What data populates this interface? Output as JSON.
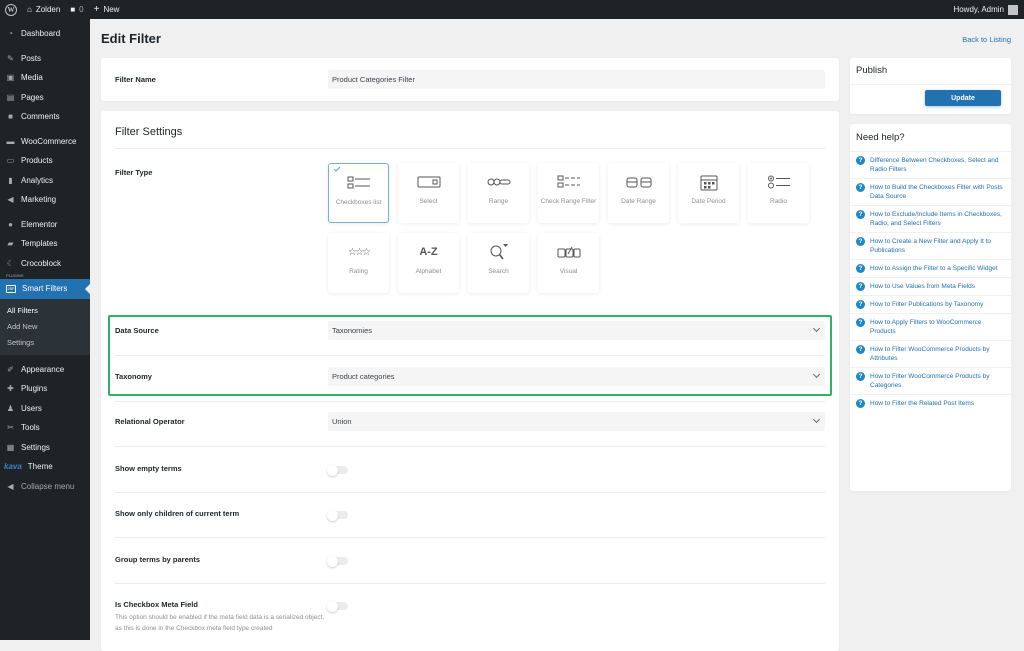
{
  "adminbar": {
    "site_name": "Zolden",
    "comments_count": "0",
    "new_label": "New",
    "howdy": "Howdy, Admin"
  },
  "sidebar": {
    "items": [
      {
        "label": "Dashboard",
        "icon": "dashboard-icon"
      },
      {
        "label": "Posts",
        "icon": "pin-icon"
      },
      {
        "label": "Media",
        "icon": "media-icon"
      },
      {
        "label": "Pages",
        "icon": "pages-icon"
      },
      {
        "label": "Comments",
        "icon": "comment-icon"
      },
      {
        "label": "WooCommerce",
        "icon": "woo-icon"
      },
      {
        "label": "Products",
        "icon": "archive-icon"
      },
      {
        "label": "Analytics",
        "icon": "bar-chart-icon"
      },
      {
        "label": "Marketing",
        "icon": "megaphone-icon"
      },
      {
        "label": "Elementor",
        "icon": "elementor-icon"
      },
      {
        "label": "Templates",
        "icon": "folder-icon"
      },
      {
        "label": "Crocoblock",
        "icon": "crocoblock-icon"
      },
      {
        "label": "Smart Filters",
        "icon": "jsf-icon"
      },
      {
        "label": "Appearance",
        "icon": "brush-icon"
      },
      {
        "label": "Plugins",
        "icon": "plugin-icon"
      },
      {
        "label": "Users",
        "icon": "user-icon"
      },
      {
        "label": "Tools",
        "icon": "wrench-icon"
      },
      {
        "label": "Settings",
        "icon": "settings-icon"
      },
      {
        "label": "Theme",
        "icon": "kava-logo",
        "logo_text": "kava"
      },
      {
        "label": "Collapse menu",
        "icon": "collapse-icon"
      }
    ],
    "plugins_tag": "PLUGINS",
    "submenu": [
      "All Filters",
      "Add New",
      "Settings"
    ]
  },
  "page": {
    "title": "Edit Filter",
    "back_link": "Back to Listing"
  },
  "filter_name": {
    "label": "Filter Name",
    "value": "Product Categories Filter"
  },
  "settings": {
    "title": "Filter Settings",
    "filter_type_label": "Filter Type",
    "filter_types": [
      {
        "label": "Checkboxes list",
        "selected": true
      },
      {
        "label": "Select",
        "selected": false
      },
      {
        "label": "Range",
        "selected": false
      },
      {
        "label": "Check Range Filter",
        "selected": false
      },
      {
        "label": "Date Range",
        "selected": false
      },
      {
        "label": "Date Period",
        "selected": false
      },
      {
        "label": "Radio",
        "selected": false
      },
      {
        "label": "Rating",
        "selected": false
      },
      {
        "label": "Alphabet",
        "selected": false
      },
      {
        "label": "Search",
        "selected": false
      },
      {
        "label": "Visual",
        "selected": false
      }
    ],
    "data_source": {
      "label": "Data Source",
      "value": "Taxonomies"
    },
    "taxonomy": {
      "label": "Taxonomy",
      "value": "Product categories"
    },
    "relational_operator": {
      "label": "Relational Operator",
      "value": "Union"
    },
    "toggles": [
      {
        "label": "Show empty terms",
        "on": false
      },
      {
        "label": "Show only children of current term",
        "on": false
      },
      {
        "label": "Group terms by parents",
        "on": false
      },
      {
        "label": "Is Checkbox Meta Field",
        "on": false,
        "description": "This option should be enabled if the meta field data is a serialized object, as this is done in the Checkbox meta field type created"
      }
    ]
  },
  "publish": {
    "title": "Publish",
    "update_label": "Update"
  },
  "help": {
    "title": "Need help?",
    "items": [
      "Difference Between Checkboxes, Select and Radio Filters",
      "How to Build the Checkboxes Filter with Posts Data Source",
      "How to Exclude/Include Items in Checkboxes, Radio, and Select Filters",
      "How to Create a New Filter and Apply It to Publications",
      "How to Assign the Filter to a Specific Widget",
      "How to Use Values from Meta Fields",
      "How to Filter Publications by Taxonomy",
      "How to Apply Filters to WooCommerce Products",
      "How to Filter WooCommerce Products by Attributes",
      "How to Filter WooCommerce Products by Categories",
      "How to Filter the Related Post Items"
    ]
  },
  "colors": {
    "accent": "#2271b1",
    "highlight_border": "#2eb36b",
    "sidebar_bg": "#1d2327"
  }
}
